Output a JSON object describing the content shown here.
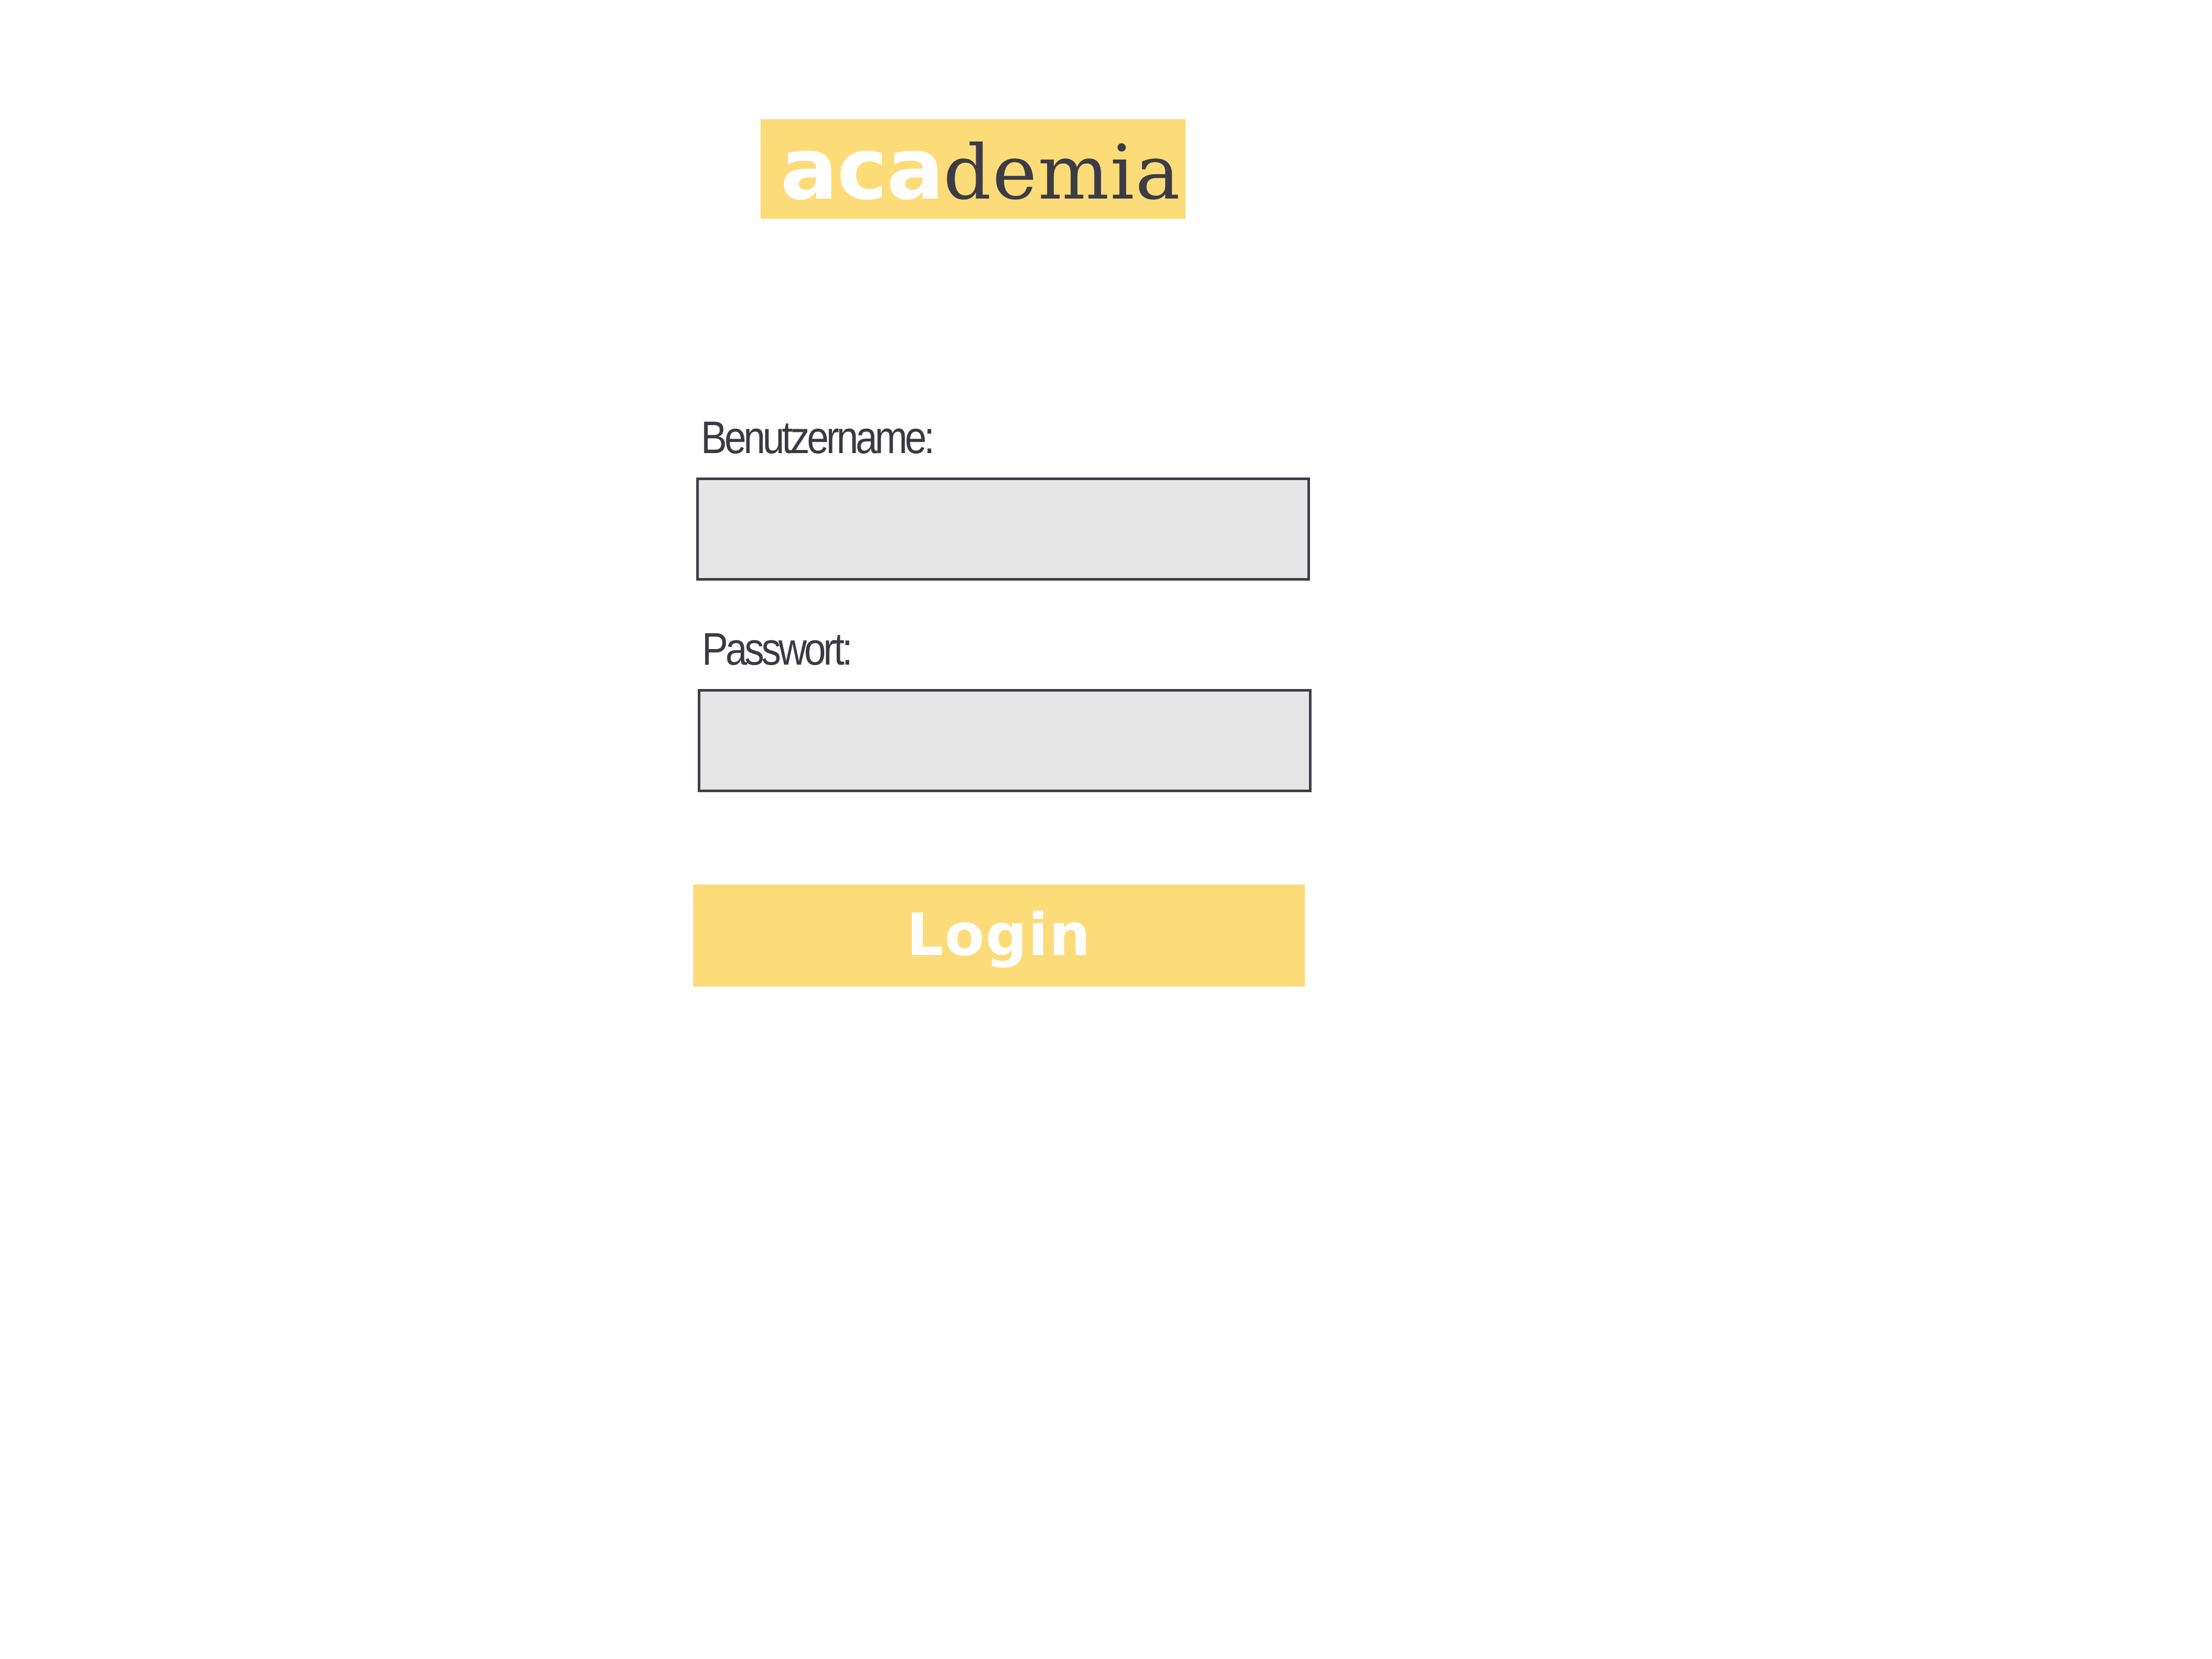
{
  "logo": {
    "text_bold": "aca",
    "text_light": "demia",
    "background_color": "#fcdc78"
  },
  "form": {
    "username_label": "Benutzername:",
    "username_value": "",
    "password_label": "Passwort:",
    "password_value": "",
    "login_label": "Login"
  },
  "colors": {
    "accent": "#fcdc78",
    "text": "#3a3a44",
    "field_background": "#e5e5e5",
    "field_border": "#3e3e48"
  }
}
